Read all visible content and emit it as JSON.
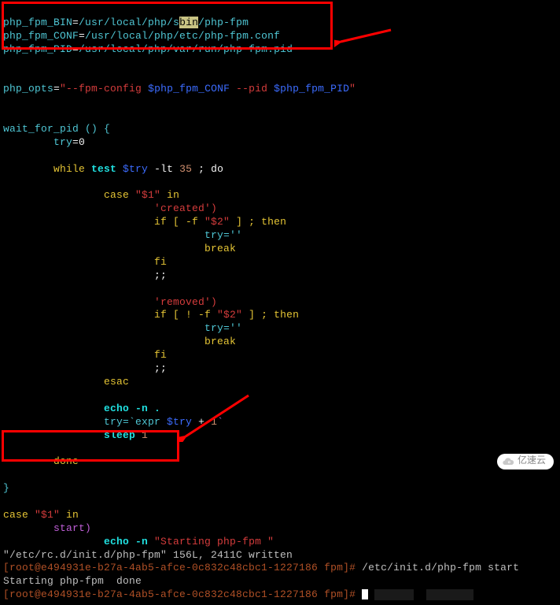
{
  "vars": {
    "bin_label": "php_fpm_BIN",
    "bin_path_pre": "/usr/local/php/s",
    "bin_hl": "bin",
    "bin_path_post": "/php-fpm",
    "conf_label": "php_fpm_CONF",
    "conf_path": "/usr/local/php/etc/php-fpm.conf",
    "pid_label": "php_fpm_PID",
    "pid_path": "/usr/local/php/var/run/php-fpm.pid"
  },
  "opts": {
    "name": "php_opts",
    "s1": "\"--fpm-config ",
    "v1": "$php_fpm_CONF",
    "s2": " --pid ",
    "v2": "$php_fpm_PID",
    "s3": "\""
  },
  "script": {
    "fn_open": "wait_for_pid () {",
    "try_assign": "try",
    "eq0": "=0",
    "while_kw": "while",
    "test_kw": " test ",
    "try_var": "$try",
    "lt": " -lt ",
    "thirtyfive": "35",
    "do_kw": " ; do",
    "case_kw": "case ",
    "dollar1": "\"$1\"",
    "in_kw": " in",
    "created": "'created')",
    "if1_a": "if [ -f ",
    "dollar2": "\"$2\"",
    "if1_b": " ] ; then",
    "try_empty": "try=''",
    "break_kw": "break",
    "fi_kw": "fi",
    "dsemi": ";;",
    "removed": "'removed')",
    "if2_a": "if [ ! -f ",
    "esac_kw": "esac",
    "echo_n": "echo -n .",
    "tryexpr_a": "try=`expr ",
    "plus": " + ",
    "one": "1",
    "tick": "`",
    "sleep_kw": "sleep ",
    "done_kw": "done",
    "brace": "}"
  },
  "case2": {
    "case_kw": "case ",
    "dollar1": "\"$1\"",
    "in_kw": " in",
    "start": "start)",
    "echo_n": "echo -n ",
    "startmsg": "\"Starting php-fpm \""
  },
  "status": {
    "written": "\"/etc/rc.d/init.d/php-fpm\" 156L, 2411C written",
    "prompt1_user": "[root@e494931e-b27a-4ab5-afce-0c832c48cbc1-1227186 fpm]# ",
    "cmd1": "/etc/init.d/php-fpm start",
    "starting": "Starting php-fpm  done",
    "prompt2_user": "[root@e494931e-b27a-4ab5-afce-0c832c48cbc1-1227186 fpm]# "
  },
  "watermark": "亿速云"
}
